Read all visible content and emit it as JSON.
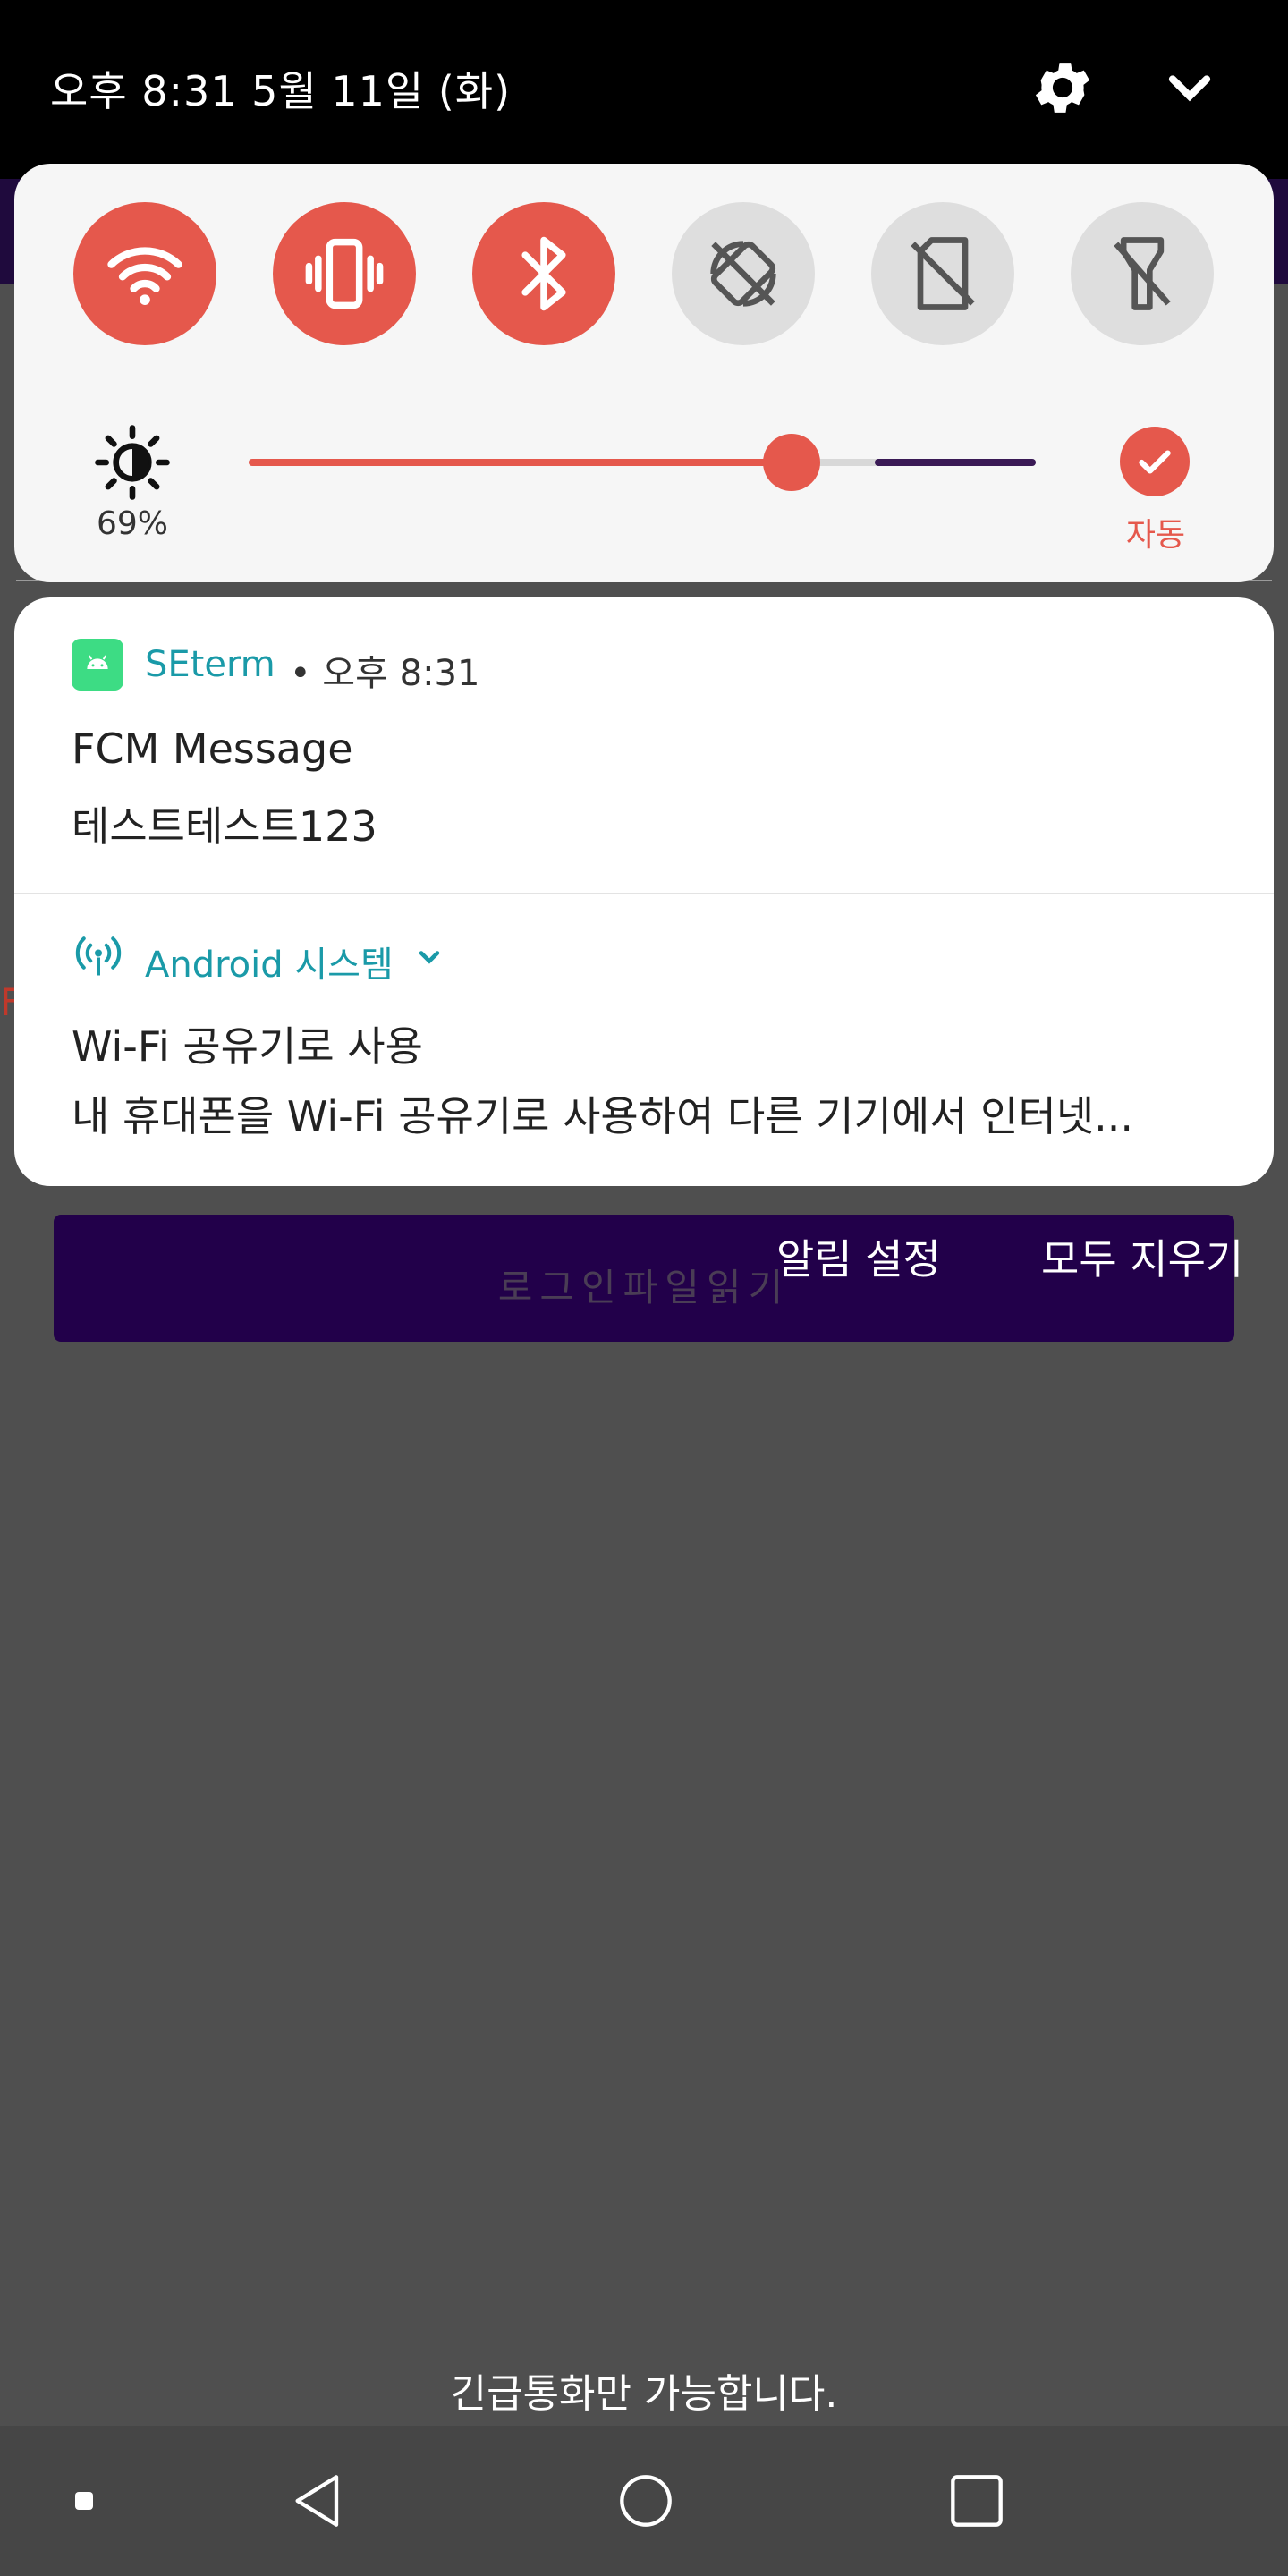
{
  "status_bar": {
    "time_date": "오후 8:31 5월 11일 (화)",
    "settings_icon": "gear-icon",
    "collapse_icon": "chevron-down-icon"
  },
  "quick_settings": {
    "tiles": [
      {
        "name": "wifi",
        "state": "on",
        "icon": "wifi-icon"
      },
      {
        "name": "vibrate",
        "state": "on",
        "icon": "vibrate-icon"
      },
      {
        "name": "bluetooth",
        "state": "on",
        "icon": "bluetooth-icon"
      },
      {
        "name": "auto-rotate",
        "state": "off",
        "icon": "rotate-off-icon"
      },
      {
        "name": "sim",
        "state": "off",
        "icon": "sim-off-icon"
      },
      {
        "name": "flashlight",
        "state": "off",
        "icon": "flashlight-off-icon"
      }
    ],
    "brightness": {
      "value_label": "69%",
      "value": 0.69,
      "auto_label": "자동"
    },
    "colors": {
      "accent": "#e5584c",
      "tile_off": "#dedede"
    }
  },
  "notifications": [
    {
      "app": "SEterm",
      "time": "• 오후 8:31",
      "title": "FCM Message",
      "text": "테스트테스트123"
    },
    {
      "app": "Android 시스템",
      "title": "Wi-Fi 공유기로 사용",
      "text": "내 휴대폰을 Wi-Fi 공유기로 사용하여 다른 기기에서 인터넷..."
    }
  ],
  "panel_actions": {
    "notification_settings": "알림 설정",
    "clear_all": "모두 지우기"
  },
  "background_app": {
    "button_label": "로그인파일읽기",
    "partial_letter": "F"
  },
  "lockscreen": {
    "emergency_text": "긴급통화만 가능합니다."
  }
}
